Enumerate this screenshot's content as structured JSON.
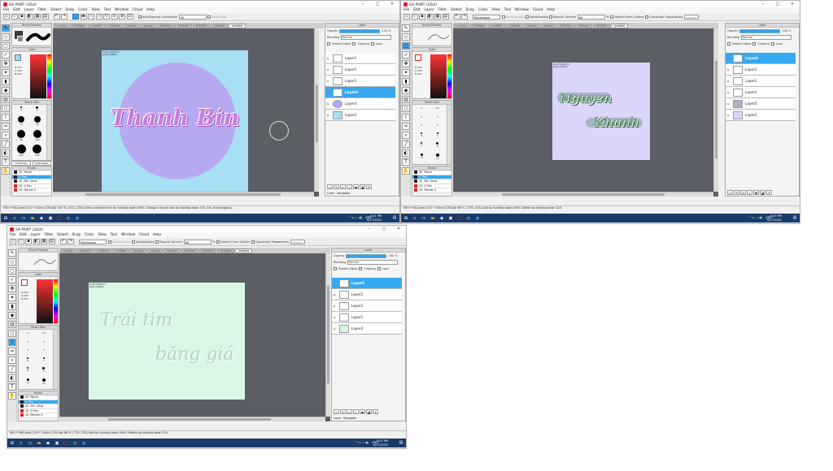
{
  "app": {
    "title": "SAI PAINT (32bit)",
    "min": "–",
    "max": "□",
    "close": "✕"
  },
  "menu": [
    "File",
    "Edit",
    "Layer",
    "Filter",
    "Select",
    "Snap",
    "Color",
    "View",
    "Tool",
    "Window",
    "Cloud",
    "Help"
  ],
  "w1": {
    "toolbar": {
      "antialias": "AntiAliasing",
      "correction_label": "Correction",
      "correction_value": "40",
      "soft_edge": "Soft Edge"
    },
    "tabs": [
      "ns.png",
      "Untitled",
      "Untitled",
      "Untitled",
      "ba.png",
      "sa.png",
      "Untitled",
      "Untitled",
      "Untitled",
      "Untitled",
      "Untitled"
    ],
    "panels": {
      "brush_preview": "Brush Preview",
      "color": "Color",
      "brush_size": "Brush Size",
      "brush": "Brush",
      "layer": "Layer"
    },
    "color_readout": "R:147\nG:222\nB:250",
    "sizes": [
      "5",
      "7",
      "10",
      "20",
      "60",
      "100",
      "200",
      "600"
    ],
    "brushes": [
      {
        "num": "20",
        "name": "Pencil",
        "color": "#222222"
      },
      {
        "num": "5",
        "name": "Pen",
        "color": "#222222"
      },
      {
        "num": "20",
        "name": "Pen (Shar",
        "color": "#222222"
      },
      {
        "num": "15",
        "name": "G Pen",
        "color": "#e02020"
      },
      {
        "num": "15",
        "name": "Marker S",
        "color": "#e02020"
      }
    ],
    "brush_btns": {
      "draft": "Draft Size",
      "multi": "Multi Paste"
    },
    "canvas_text": "Thanh Bin",
    "corner_label": "by.sinh@artsm\n@parelal8ae",
    "layer": {
      "opacity_label": "Opacity",
      "opacity_value": "100 %",
      "blending_label": "Blending",
      "blending_value": "Normal",
      "protect": "Protect Alpha",
      "clipping": "Clipping",
      "lock": "Lock"
    },
    "layers": [
      "Layer1",
      "Layer1",
      "Layer1",
      "Layer6",
      "Layer3",
      "Layer2"
    ],
    "layer_footer": "Layer   Navigator",
    "status": "900 * 900 pixel  (3.6 * 3.6cm)  250 dpi  100 %  ( 812, 276)  Draw a straight line by holding down Shift. Change a brush size by holding down Ctrl, Alt, and dragging.",
    "clock_time": "4:41 PM",
    "clock_date": "6/17/2021",
    "lang": "ENG"
  },
  "w2": {
    "toolbar": {
      "shape": "Rectangle",
      "snap": "Snap to grid",
      "antialias": "AntiAliasing",
      "round": "Round Corners",
      "round_value": "60",
      "pct": "%",
      "from_center": "Select From Center",
      "constrain": "Constrain Proportions",
      "header_btn": "Header"
    },
    "tabs": [
      "ns.png",
      "Untitled",
      "Untitled",
      "Untitled",
      "ba.png",
      "sa.png",
      "Untitled",
      "Untitled",
      "Untitled",
      "Untitled"
    ],
    "panels": {
      "brush_preview": "Brush Preview",
      "color": "Color",
      "brush_size": "Brush Size",
      "brush": "Brush",
      "layer": "Layer"
    },
    "color_readout": "R:255\nG:255\nB:255",
    "sizes": [
      "1",
      "1.5",
      "2",
      "3",
      "4",
      "5",
      "6",
      "7",
      "8",
      "9",
      "10",
      "12"
    ],
    "brushes": [
      {
        "num": "20",
        "name": "Pencil",
        "color": "#222222"
      },
      {
        "num": "5",
        "name": "Pen",
        "color": "#222222"
      },
      {
        "num": "20",
        "name": "Pen (Shar",
        "color": "#222222"
      },
      {
        "num": "15",
        "name": "G Pen",
        "color": "#e02020"
      },
      {
        "num": "15",
        "name": "Marker S",
        "color": "#e02020"
      }
    ],
    "canvas_text_1": "Nguyen",
    "canvas_text_2": "Khanh",
    "corner_label": "by.sinh@artsm\n@parelal8ae",
    "layer": {
      "opacity_label": "Opacity",
      "opacity_value": "100 %",
      "blending_label": "Blending",
      "blending_value": "Normal",
      "protect": "Protect Alpha",
      "clipping": "Clipping",
      "lock": "Lock"
    },
    "layers": [
      "Layer6",
      "Layer1",
      "Layer1",
      "Layer1",
      "Layer5",
      "Layer2"
    ],
    "status": "900 * 900 pixel  (3.6 * 3.6cm)  250 dpi  66 %  ( 735, 315)  Add by holding down Shift. Delete by holding down Ctrl.",
    "clock_time": "4:45 PM",
    "clock_date": "6/17/2021",
    "lang": "ENG"
  },
  "w3": {
    "toolbar": {
      "shape": "Rectangle",
      "snap": "Snap to grid",
      "antialias": "AntiAliasing",
      "round": "Round Corners",
      "round_value": "60",
      "pct": "%",
      "from_center": "Select From Center",
      "constrain": "Constrain Proportions",
      "header_btn": "Header"
    },
    "tabs": [
      "ns.png",
      "Untitled",
      "Untitled",
      "Untitled",
      "ba.png",
      "sa.png",
      "Untitled",
      "Untitled",
      "Untitled",
      "Untitled",
      "Untitled"
    ],
    "panels": {
      "brush_preview": "Brush Preview",
      "color": "Color",
      "brush_size": "Brush Size",
      "brush": "Brush",
      "layer": "Layer"
    },
    "color_readout": "R:255\nG:255\nB:255",
    "sizes": [
      "1",
      "1.5",
      "2",
      "3",
      "4",
      "5",
      "6",
      "7",
      "8",
      "9",
      "10",
      "12"
    ],
    "brushes": [
      {
        "num": "20",
        "name": "Pencil",
        "color": "#222222"
      },
      {
        "num": "5",
        "name": "Pen",
        "color": "#222222"
      },
      {
        "num": "20",
        "name": "Pen (Shar",
        "color": "#222222"
      },
      {
        "num": "15",
        "name": "G Pen",
        "color": "#e02020"
      },
      {
        "num": "15",
        "name": "Marker S",
        "color": "#e02020"
      }
    ],
    "canvas_text_1": "Trái tim",
    "canvas_text_2": "băng giá",
    "corner_label": "by.sinh@artsm\n@parelal8ae",
    "layer": {
      "opacity_label": "Opacity",
      "opacity_value": "100 %",
      "blending_label": "Blending",
      "blending_value": "Normal",
      "protect": "Protect Alpha",
      "clipping": "Clipping",
      "lock": "Lock"
    },
    "layers": [
      "Layer5",
      "Layer1",
      "Layer1",
      "Layer1",
      "Layer2"
    ],
    "layer_footer": "Layer   Navigator",
    "status": "900 * 900 pixel  (3.6 * 3.6cm)  250 dpi  66 %  ( 735, 315)  Add by holding down Shift. Delete by holding down Ctrl.",
    "clock_time": "4:52 PM",
    "clock_date": "6/17/2021",
    "lang": "ENG"
  },
  "colors": {
    "accent": "#36a9f0",
    "canvas_bg": "#5b5e64",
    "taskbar": "#1a3a6a",
    "w1_paper": "#a8dff5",
    "w1_circle": "#b7a9f0",
    "w1_text": "#c77be0",
    "w2_paper": "#d9d6fa",
    "w2_text": "#6fa67e",
    "w3_paper": "#daf7e5",
    "w3_text": "#b2d4c0"
  },
  "icons": [
    "pencil-icon",
    "eraser-icon",
    "select-icon",
    "lasso-icon",
    "move-icon",
    "zoom-icon",
    "rotate-icon",
    "hand-icon",
    "eyedropper-icon",
    "text-icon",
    "bucket-icon",
    "undo-icon",
    "redo-icon",
    "eye-icon",
    "new-layer-icon",
    "folder-icon",
    "trash-icon",
    "windows-icon",
    "search-icon",
    "chrome-icon",
    "photoshop-icon"
  ]
}
